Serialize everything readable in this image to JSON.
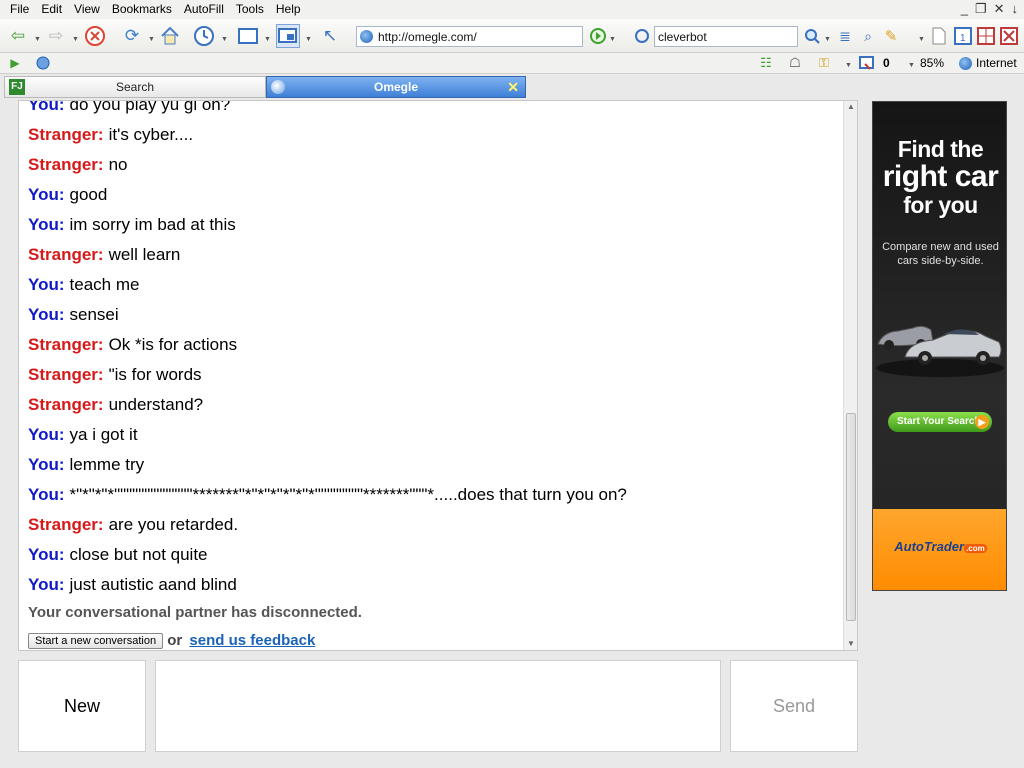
{
  "browser": {
    "menu": [
      "File",
      "Edit",
      "View",
      "Bookmarks",
      "AutoFill",
      "Tools",
      "Help"
    ],
    "window_controls": [
      "_",
      "❐",
      "✕",
      "↓"
    ],
    "address": "http://omegle.com/",
    "search_query": "cleverbot",
    "zoom": "85%",
    "zone": "Internet",
    "zone_count": "0",
    "tabs": [
      {
        "label": "Search",
        "icon_text": "FJ"
      },
      {
        "label": "Omegle",
        "close": "✕"
      }
    ]
  },
  "chat": {
    "messages": [
      {
        "who": "You:",
        "role": "you",
        "text": "do you play yu gi oh?"
      },
      {
        "who": "Stranger:",
        "role": "stranger",
        "text": "it's cyber...."
      },
      {
        "who": "Stranger:",
        "role": "stranger",
        "text": "no"
      },
      {
        "who": "You:",
        "role": "you",
        "text": "good"
      },
      {
        "who": "You:",
        "role": "you",
        "text": "im sorry im bad at this"
      },
      {
        "who": "Stranger:",
        "role": "stranger",
        "text": "well learn"
      },
      {
        "who": "You:",
        "role": "you",
        "text": "teach me"
      },
      {
        "who": "You:",
        "role": "you",
        "text": "sensei"
      },
      {
        "who": "Stranger:",
        "role": "stranger",
        "text": "Ok *is for actions"
      },
      {
        "who": "Stranger:",
        "role": "stranger",
        "text": "\"is for words"
      },
      {
        "who": "Stranger:",
        "role": "stranger",
        "text": "understand?"
      },
      {
        "who": "You:",
        "role": "you",
        "text": "ya i got it"
      },
      {
        "who": "You:",
        "role": "you",
        "text": "lemme try"
      },
      {
        "who": "You:",
        "role": "you",
        "text": "*\"*\"*\"*\"\"\"\"\"\"\"\"\"\"\"\"\"*******\"*\"*\"*\"*\"*\"*\"\"\"\"\"\"\"\"*******\"\"\"*.....does that turn you on?"
      },
      {
        "who": "Stranger:",
        "role": "stranger",
        "text": "are you retarded."
      },
      {
        "who": "You:",
        "role": "you",
        "text": "close but not quite"
      },
      {
        "who": "You:",
        "role": "you",
        "text": "just autistic aand blind"
      }
    ],
    "status": "Your conversational partner has disconnected.",
    "new_conversation_label": "Start a new conversation",
    "or_text": "or",
    "feedback_link": "send us feedback"
  },
  "controls": {
    "new_label": "New",
    "send_label": "Send",
    "message_value": ""
  },
  "ad": {
    "headline_1": "Find the",
    "headline_2": "right car",
    "headline_3": "for you",
    "subtext": "Compare new and used cars side-by-side.",
    "cta": "Start Your Search",
    "brand": "AutoTrader",
    "brand_suffix": ".com"
  },
  "colors": {
    "you": "#1019c8",
    "stranger": "#d61a1a",
    "link": "#1a63b8",
    "ad_orange": "#ff8c00"
  }
}
